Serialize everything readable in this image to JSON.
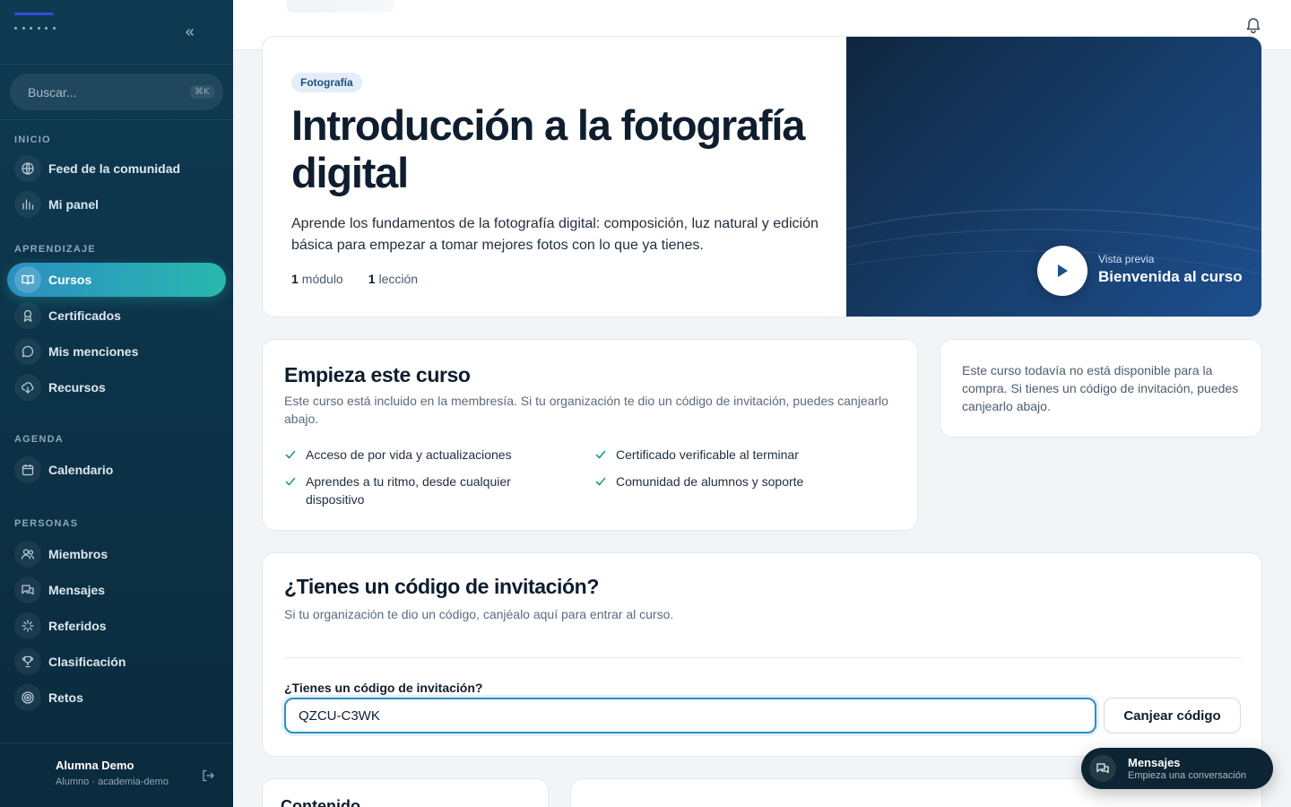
{
  "sidebar": {
    "collapse_icon": "chevrons-left-icon",
    "search": {
      "placeholder": "Buscar...",
      "shortcut": "⌘K"
    },
    "sections": [
      {
        "label": "INICIO",
        "items": [
          {
            "label": "Feed de la comunidad",
            "icon": "globe-icon"
          },
          {
            "label": "Mi panel",
            "icon": "bar-chart-icon"
          }
        ]
      },
      {
        "label": "APRENDIZAJE",
        "items": [
          {
            "label": "Cursos",
            "icon": "book-open-icon",
            "active": true
          },
          {
            "label": "Certificados",
            "icon": "award-icon"
          },
          {
            "label": "Mis menciones",
            "icon": "message-circle-icon"
          },
          {
            "label": "Recursos",
            "icon": "cloud-download-icon"
          }
        ]
      },
      {
        "label": "AGENDA",
        "items": [
          {
            "label": "Calendario",
            "icon": "calendar-icon"
          }
        ]
      },
      {
        "label": "PERSONAS",
        "items": [
          {
            "label": "Miembros",
            "icon": "users-icon"
          },
          {
            "label": "Mensajes",
            "icon": "messages-icon"
          },
          {
            "label": "Referidos",
            "icon": "sparkle-icon"
          },
          {
            "label": "Clasificación",
            "icon": "trophy-icon"
          },
          {
            "label": "Retos",
            "icon": "target-icon"
          }
        ]
      }
    ],
    "user": {
      "name": "Alumna Demo",
      "role": "Alumno · academia-demo"
    }
  },
  "course": {
    "category": "Fotografía",
    "title": "Introducción a la fotografía digital",
    "description": "Aprende los fundamentos de la fotografía digital: composición, luz natural y edición básica para empezar a tomar mejores fotos con lo que ya tienes.",
    "stats": [
      {
        "count": "1",
        "label": "módulo"
      },
      {
        "count": "1",
        "label": "lección"
      }
    ],
    "preview": {
      "label": "Vista previa",
      "title": "Bienvenida al curso"
    }
  },
  "start_card": {
    "title": "Empieza este curso",
    "subtitle": "Este curso está incluido en la membresía. Si tu organización te dio un código de invitación, puedes canjearlo abajo.",
    "features": [
      "Acceso de por vida y actualizaciones",
      "Certificado verificable al terminar",
      "Aprendes a tu ritmo, desde cualquier dispositivo",
      "Comunidad de alumnos y soporte"
    ]
  },
  "notice": {
    "text": "Este curso todavía no está disponible para la compra. Si tienes un código de invitación, puedes canjearlo abajo."
  },
  "invite": {
    "title": "¿Tienes un código de invitación?",
    "subtitle": "Si tu organización te dio un código, canjéalo aquí para entrar al curso.",
    "field_label": "¿Tienes un código de invitación?",
    "code_value": "QZCU-C3WK",
    "button": "Canjear código"
  },
  "content_card": {
    "title": "Contenido"
  },
  "messages_widget": {
    "title": "Mensajes",
    "subtitle": "Empieza una conversación"
  },
  "colors": {
    "accent_start": "#2c8fc2",
    "accent_end": "#28b8ad",
    "sidebar_bg": "#0e3a52",
    "check": "#1f9a8a"
  }
}
